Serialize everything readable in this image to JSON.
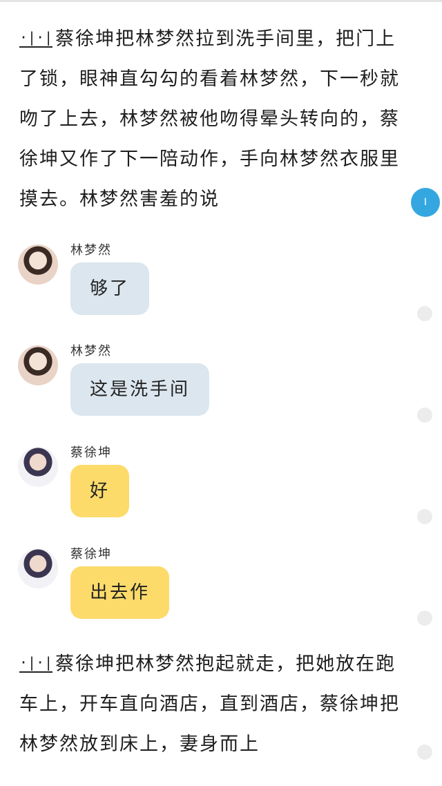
{
  "paragraph1": {
    "marker": "·|·|",
    "text": "蔡徐坤把林梦然拉到洗手间里，把门上了锁，眼神直勾勾的看着林梦然，下一秒就吻了上去，林梦然被他吻得晕头转向的，蔡徐坤又作了下一陪动作，手向林梦然衣服里摸去。林梦然害羞的说"
  },
  "messages": [
    {
      "name": "林梦然",
      "text": "够了",
      "color": "#dbe6ee"
    },
    {
      "name": "林梦然",
      "text": "这是洗手间",
      "color": "#dbe6ee"
    },
    {
      "name": "蔡徐坤",
      "text": "好",
      "color": "#fcdb6b"
    },
    {
      "name": "蔡徐坤",
      "text": "出去作",
      "color": "#fcdb6b"
    }
  ],
  "paragraph2": {
    "marker": "·|·|",
    "text": "蔡徐坤把林梦然抱起就走，把她放在跑车上，开车直向酒店，直到酒店，蔡徐坤把林梦然放到床上，妻身而上"
  },
  "side_marker": {
    "label": "I",
    "accent": "#35a7e0"
  }
}
